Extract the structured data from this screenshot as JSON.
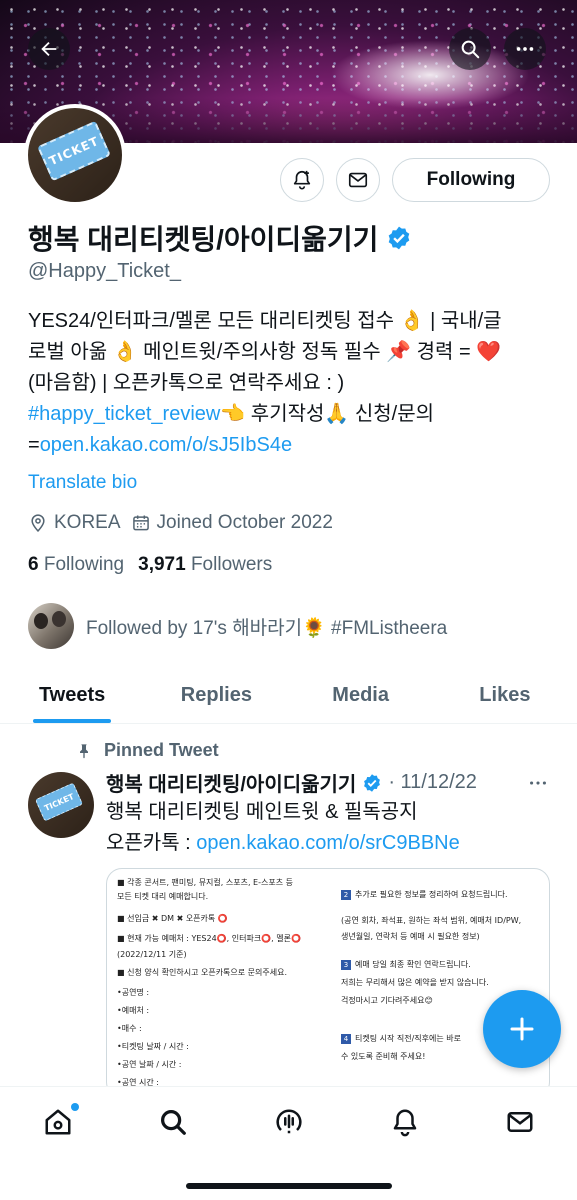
{
  "header": {
    "back_icon": "arrow-left-icon",
    "search_icon": "search-icon",
    "more_icon": "more-horizontal-icon"
  },
  "avatar": {
    "ticket_text": "TICKET"
  },
  "actions": {
    "notify_icon": "bell-plus-icon",
    "message_icon": "envelope-icon",
    "follow_label": "Following"
  },
  "profile": {
    "name": "행복 대리티켓팅/아이디옮기기",
    "handle": "@Happy_Ticket_",
    "bio_line1": "YES24/인터파크/멜론 모든 대리티켓팅 접수 👌 | 국내/글",
    "bio_line2": "로벌 아옮 👌 메인트윗/주의사항 정독 필수 📌 경력 = ❤️",
    "bio_line3": "(마음함) | 오픈카톡으로 연락주세요 : )",
    "bio_hashtag": "#happy_ticket_review",
    "bio_line4_rest": "👈 후기작성🙏 신청/문의",
    "bio_line5_prefix": "=",
    "bio_link": "open.kakao.com/o/sJ5IbS4e",
    "translate": "Translate bio",
    "location": "KOREA",
    "joined": "Joined October 2022",
    "following_count": "6",
    "following_label": "Following",
    "followers_count": "3,971",
    "followers_label": "Followers",
    "followed_by": "Followed by 17's 해바라기🌻 #FMListheera"
  },
  "tabs": [
    {
      "label": "Tweets",
      "active": true
    },
    {
      "label": "Replies",
      "active": false
    },
    {
      "label": "Media",
      "active": false
    },
    {
      "label": "Likes",
      "active": false
    }
  ],
  "tweet": {
    "pinned_label": "Pinned Tweet",
    "author": "행복 대리티켓팅/아이디옮기기",
    "date": "· 11/12/22",
    "line1": "행복 대리티켓팅 메인트윗 & 필독공지",
    "line2_prefix": "오픈카톡 : ",
    "link": "open.kakao.com/o/srC9BBNe",
    "media": {
      "left_rows": [
        "■ 각종 콘서트, 팬미팅, 뮤지컬, 스포츠, E-스포츠 등",
        "   모든 티켓 대리 예매합니다.",
        "■ 선입금 ✖ DM ✖ 오픈카톡 ⭕",
        "■ 현재 가능 예매처 : YES24⭕, 인터파크⭕, 멜론⭕",
        "(2022/12/11 기준)",
        "■ 신청 양식 확인하시고 오픈카톡으로 문의주세요.",
        "•공연명 :",
        "•예매처 :",
        "•매수 :",
        "•티켓팅 날짜 / 시간 :",
        "•공연 날짜 / 시간 :",
        "•공연 시간 :"
      ],
      "right_rows": [
        {
          "num": "2",
          "text": "추가로 필요한 정보를 정리하여 요청드립니다."
        },
        {
          "num": "",
          "text": "(공연 회차, 좌석표, 원하는 좌석 범위, 예매처 ID/PW,"
        },
        {
          "num": "",
          "text": "생년월일, 연락처 등 예매 시 필요한 정보)"
        },
        {
          "num": "3",
          "text": "예매 당일 최종 확인 연락드립니다."
        },
        {
          "num": "",
          "text": "저희는 무리해서 많은 예약을 받지 않습니다."
        },
        {
          "num": "",
          "text": "걱정마시고 기다려주세요😊"
        },
        {
          "num": "4",
          "text": "티켓팅 시작 직전/직후에는 바로"
        },
        {
          "num": "",
          "text": "수 있도록 준비해 주세요!"
        }
      ]
    }
  },
  "fab_icon": "plus-icon",
  "nav": [
    "home-icon",
    "search-icon",
    "spaces-icon",
    "notifications-icon",
    "messages-icon"
  ]
}
